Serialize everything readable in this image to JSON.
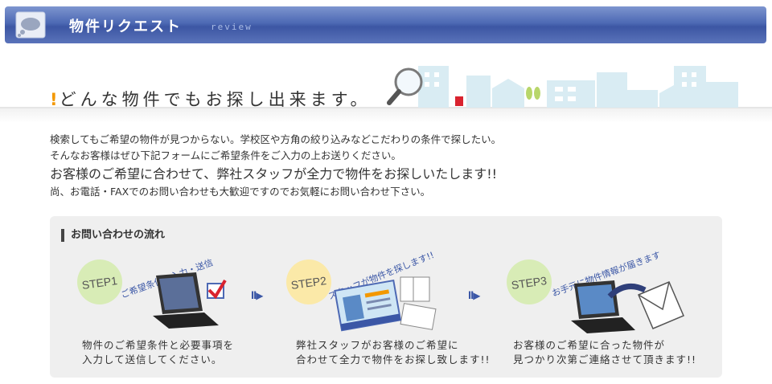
{
  "header": {
    "title": "物件リクエスト",
    "subtitle": "review"
  },
  "banner": {
    "mark": "!",
    "headline": "どんな物件でもお探し出来ます。"
  },
  "intro": {
    "line1": "検索してもご希望の物件が見つからない。学校区や方角の絞り込みなどこだわりの条件で探したい。",
    "line2": "そんなお客様はぜひ下記フォームにご希望条件をご入力の上お送りください。",
    "emphasis": "お客様のご希望に合わせて、弊社スタッフが全力で物件をお探しいたします!!",
    "line4": "尚、お電話・FAXでのお問い合わせも大歓迎ですのでお気軽にお問い合わせ下さい。"
  },
  "flow": {
    "title": "お問い合わせの流れ",
    "arrow": "ll▶",
    "steps": [
      {
        "badge": "STEP1",
        "caption": "ご希望条件の入力・送信",
        "desc1": "物件のご希望条件と必要事項を",
        "desc2": "入力して送信してください。"
      },
      {
        "badge": "STEP2",
        "caption": "スタッフが物件を探します!!",
        "desc1": "弊社スタッフがお客様のご希望に",
        "desc2": "合わせて全力で物件をお探し致します!!"
      },
      {
        "badge": "STEP3",
        "caption": "お手元に物件情報が届きます",
        "desc1": "お客様のご希望に合った物件が",
        "desc2": "見つかり次第ご連絡させて頂きます!!"
      }
    ]
  },
  "colors": {
    "header": "#4d69b4",
    "accent": "#f39800",
    "step_badge": "#d8ecb6",
    "caption": "#3b57a6",
    "panel": "#efefef"
  }
}
